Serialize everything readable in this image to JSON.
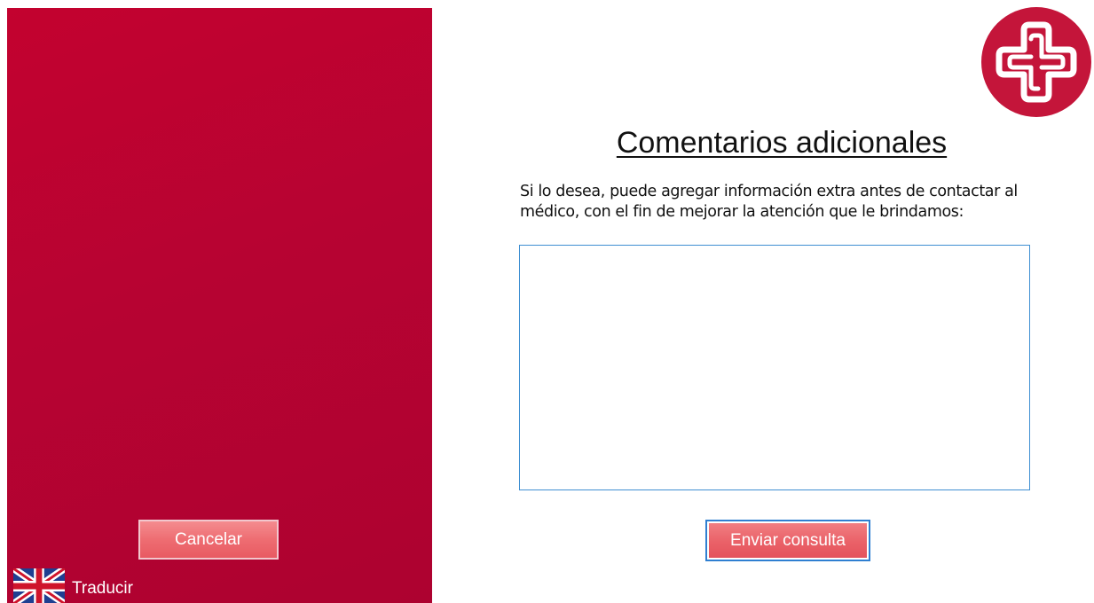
{
  "sidebar": {
    "cancel_label": "Cancelar",
    "translate_label": "Traducir",
    "flag_icon": "uk-flag-icon"
  },
  "header": {
    "logo_icon": "medical-cross-logo"
  },
  "main": {
    "title": "Comentarios adicionales",
    "description": "Si lo desea, puede agregar información extra antes de contactar al médico, con el fin de mejorar la atención que le brindamos:",
    "comments_value": "",
    "comments_placeholder": "",
    "submit_label": "Enviar consulta"
  },
  "colors": {
    "brand_red": "#c0022f",
    "button_red": "#ee6d72",
    "focus_blue": "#2f7fd1"
  }
}
